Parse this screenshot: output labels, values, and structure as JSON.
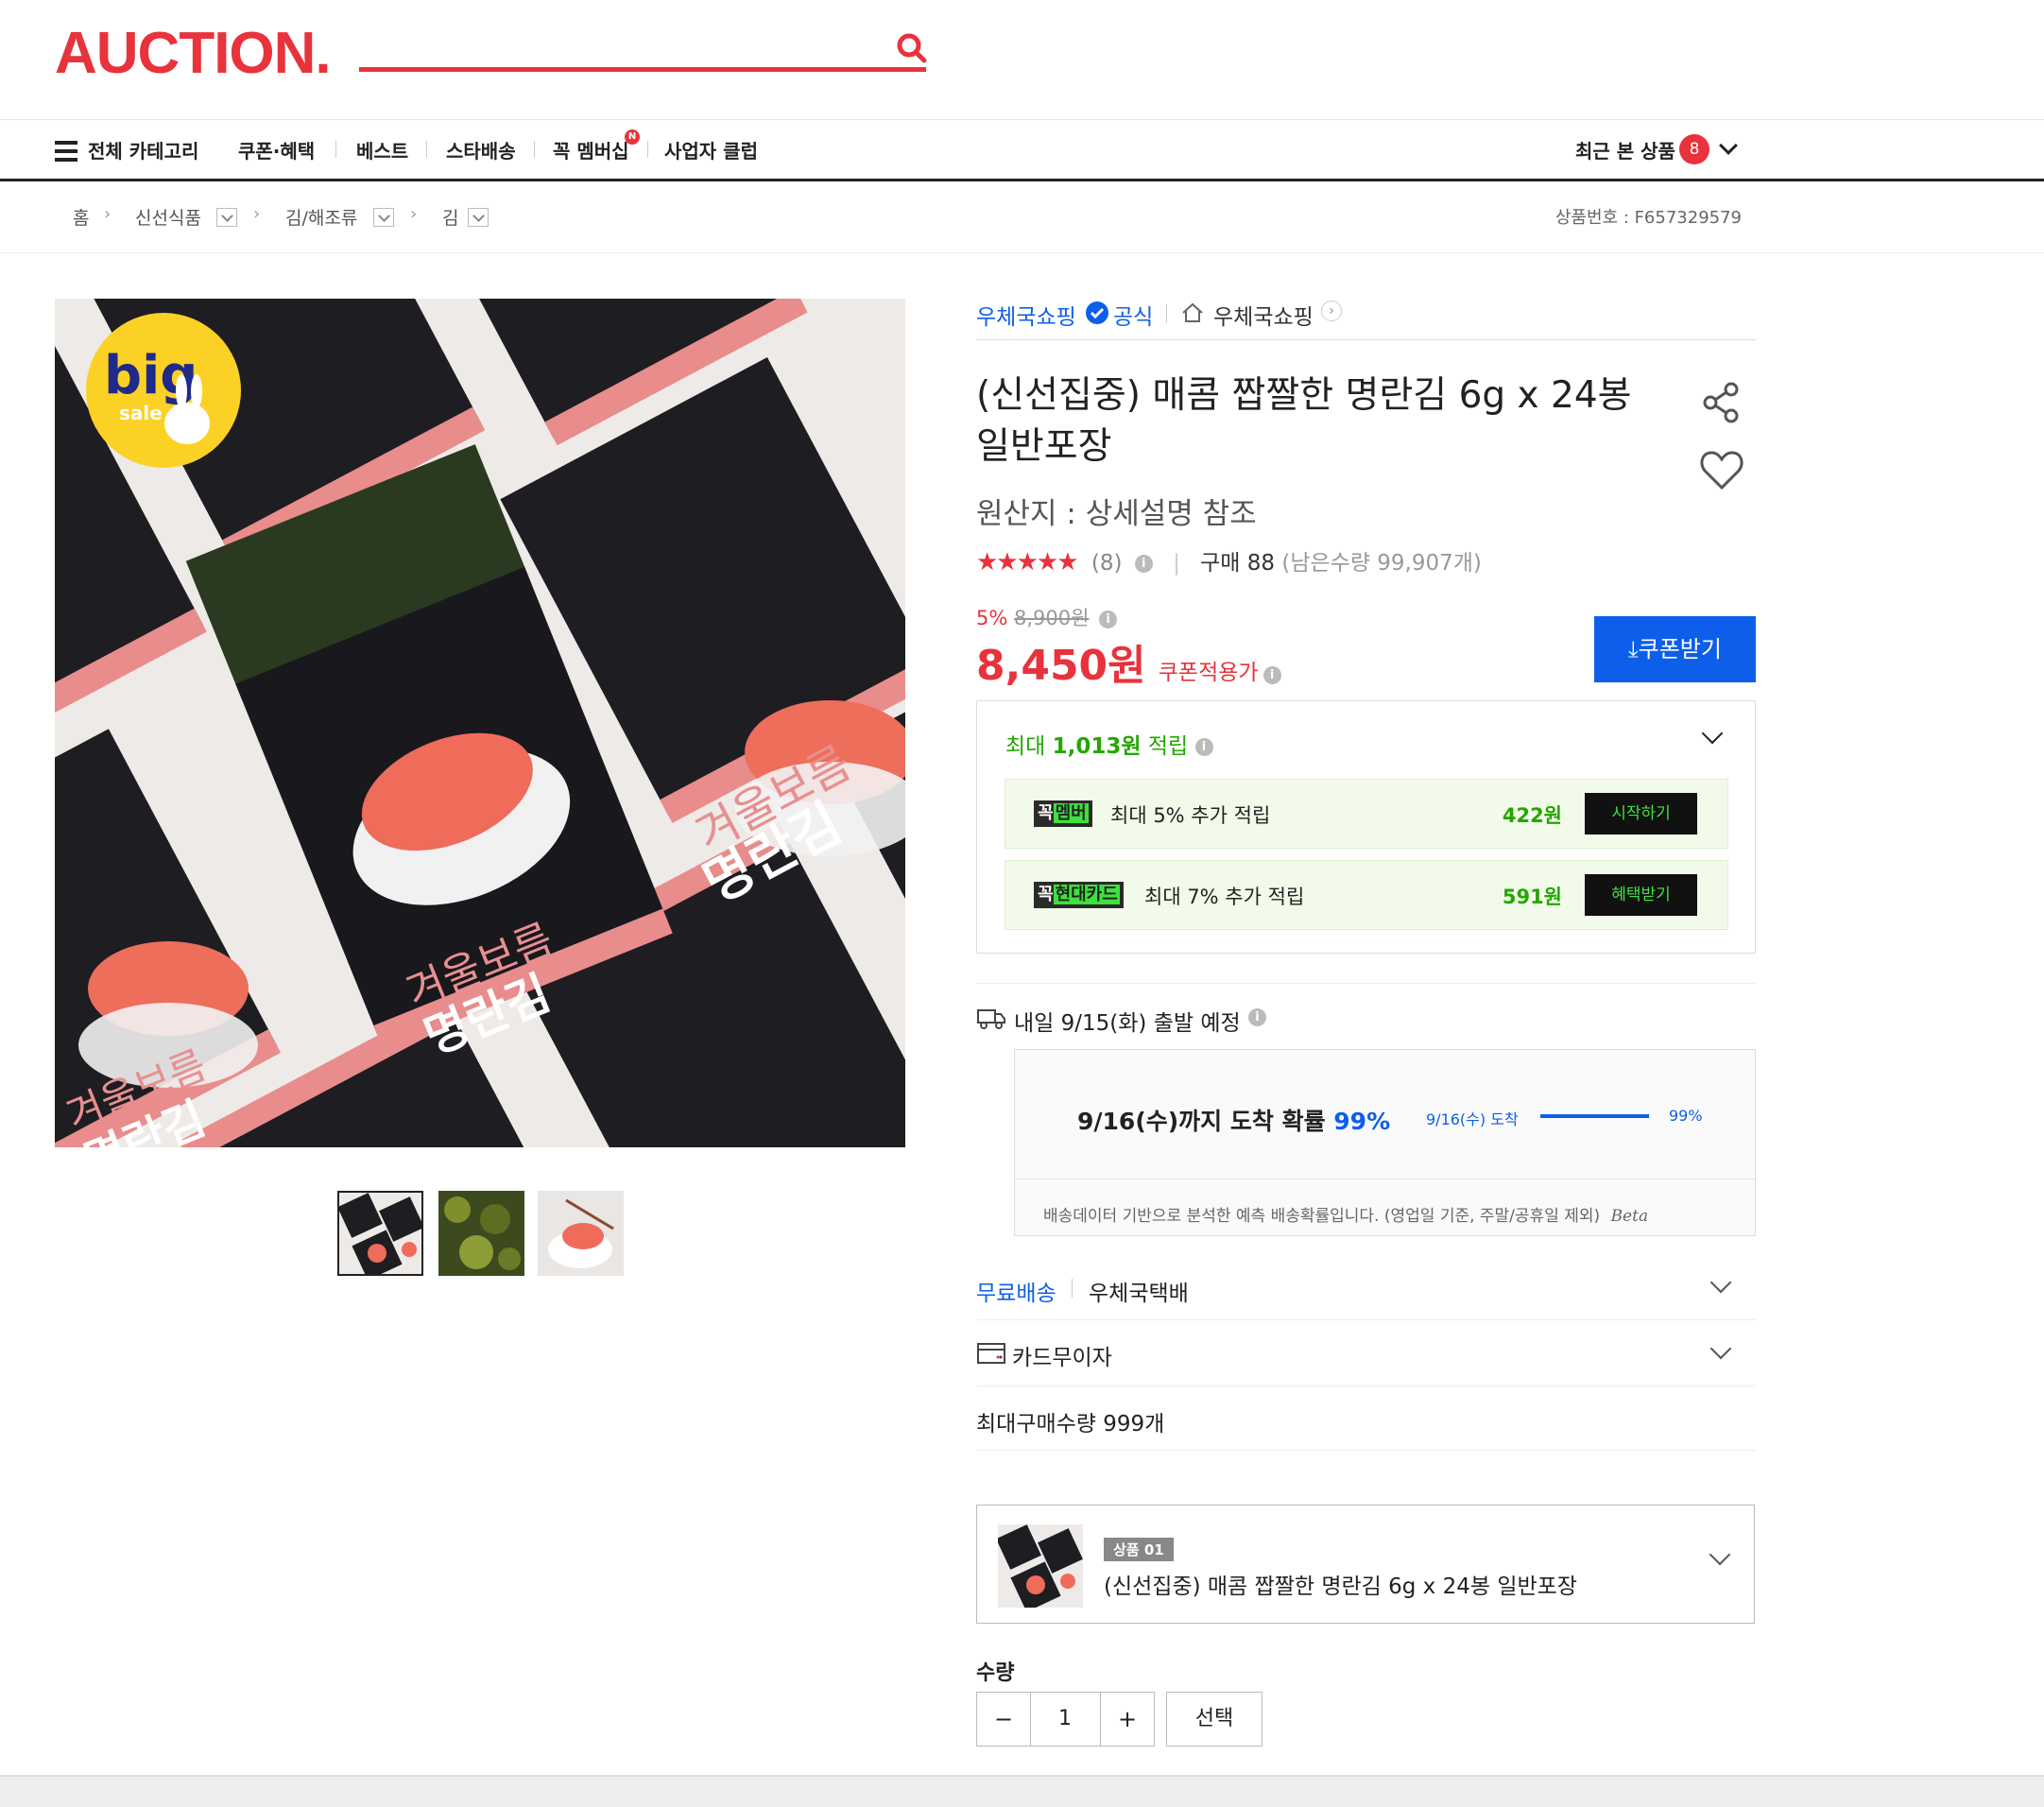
{
  "header": {
    "logo": "AUCTION.",
    "search": {
      "placeholder": "",
      "value": ""
    }
  },
  "nav": {
    "all_categories": "전체 카테고리",
    "items": [
      "쿠폰·혜택",
      "베스트",
      "스타배송",
      "꼭 멤버십",
      "사업자 클럽"
    ],
    "membership_badge": "N",
    "recent_label": "최근 본 상품",
    "recent_count": "8"
  },
  "breadcrumb": {
    "home": "홈",
    "items": [
      "신선식품",
      "김/해조류",
      "김"
    ],
    "product_number": "상품번호 : F657329579"
  },
  "gallery": {
    "badge_big": "big",
    "badge_sale": "sale",
    "pack_text_1": "겨울보름",
    "pack_text_2": "명란김",
    "thumbnail_count": 3
  },
  "seller": {
    "name": "우체국쇼핑",
    "official_label": "공식",
    "store_name": "우체국쇼핑"
  },
  "product": {
    "title": "(신선집중) 매콤 짭짤한 명란김 6g x 24봉 일반포장",
    "origin": "원산지 : 상세설명 참조",
    "stars": "★★★★★",
    "review_count": "(8)",
    "purchase_label": "구매 88",
    "remaining": "(남은수량 99,907개)",
    "rating": 5
  },
  "price": {
    "discount_rate": "5%",
    "original": "8,900원",
    "final": "8,450원",
    "coupon_applied_label": "쿠폰적용가",
    "coupon_button": "쿠폰받기"
  },
  "reward": {
    "max_label_prefix": "최대 ",
    "max_amount": "1,013원",
    "max_label_suffix": " 적립",
    "rows": [
      {
        "badge_prefix": "꼭",
        "badge": "멤버",
        "text": "최대 5% 추가 적립",
        "amount": "422원",
        "button": "시작하기"
      },
      {
        "badge_prefix": "꼭",
        "badge": "현대카드",
        "text": "최대 7% 추가 적립",
        "amount": "591원",
        "button": "혜택받기"
      }
    ]
  },
  "shipping": {
    "departure": "내일 9/15(화) 출발 예정",
    "arrival_headline": "9/16(수)까지 도착 확률 ",
    "arrival_percent": "99%",
    "bar_label": "9/16(수) 도착",
    "bar_value": "99%",
    "bar_fraction": 0.99,
    "note": "배송데이터 기반으로 분석한 예측 배송확률입니다. (영업일 기준, 주말/공휴일 제외)",
    "beta": "Beta"
  },
  "options": {
    "free_shipping": "무료배송",
    "carrier": "우체국택배",
    "card": "카드무이자",
    "max_purchase": "최대구매수량 999개"
  },
  "selected_item": {
    "tag": "상품 01",
    "name": "(신선집중) 매콤 짭짤한 명란김 6g x 24봉 일반포장"
  },
  "quantity": {
    "label": "수량",
    "minus": "−",
    "value": "1",
    "plus": "+",
    "select_button": "선택"
  },
  "colors": {
    "brand": "#e8323c",
    "blue": "#0d5fe9",
    "green": "#24a700",
    "neon": "#3de23c"
  }
}
